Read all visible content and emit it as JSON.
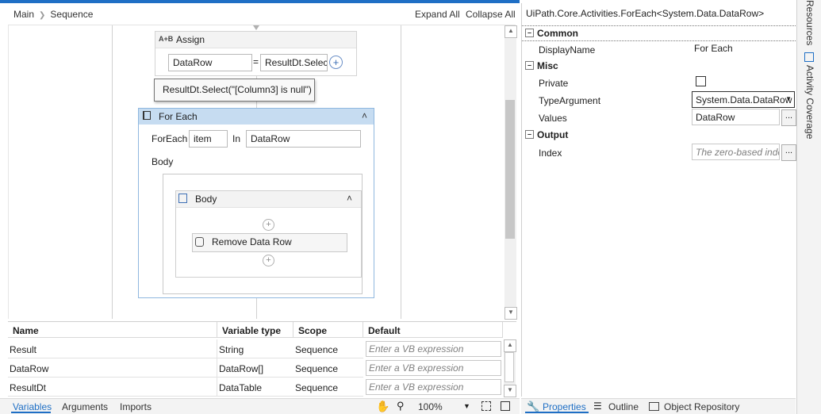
{
  "breadcrumb": [
    "Main",
    "Sequence"
  ],
  "header": {
    "expand_all": "Expand All",
    "collapse_all": "Collapse All"
  },
  "assign": {
    "title": "Assign",
    "icon": "A+B",
    "to": "DataRow",
    "eq": "=",
    "value": "ResultDt.Select"
  },
  "tooltip": "ResultDt.Select(\"[Column3] is null\")",
  "foreach": {
    "title": "For Each",
    "foreach_label": "ForEach",
    "item": "item",
    "in_label": "In",
    "values": "DataRow",
    "body_label": "Body",
    "inner_title": "Body",
    "activity": "Remove Data Row"
  },
  "variables": {
    "columns": [
      "Name",
      "Variable type",
      "Scope",
      "Default"
    ],
    "rows": [
      {
        "name": "Result",
        "type": "String",
        "scope": "Sequence",
        "default": "Enter a VB expression"
      },
      {
        "name": "DataRow",
        "type": "DataRow[]",
        "scope": "Sequence",
        "default": "Enter a VB expression"
      },
      {
        "name": "ResultDt",
        "type": "DataTable",
        "scope": "Sequence",
        "default": "Enter a VB expression"
      }
    ]
  },
  "bottom_tabs": [
    "Variables",
    "Arguments",
    "Imports"
  ],
  "zoom": "100%",
  "properties": {
    "title": "UiPath.Core.Activities.ForEach<System.Data.DataRow>",
    "categories": {
      "common": "Common",
      "misc": "Misc",
      "output": "Output"
    },
    "display_name": {
      "label": "DisplayName",
      "value": "For Each"
    },
    "private": {
      "label": "Private"
    },
    "type_argument": {
      "label": "TypeArgument",
      "value": "System.Data.DataRow"
    },
    "values": {
      "label": "Values",
      "value": "DataRow"
    },
    "index": {
      "label": "Index",
      "placeholder": "The zero-based index"
    },
    "ellipsis": "..."
  },
  "props_tabs": [
    "Properties",
    "Outline",
    "Object Repository"
  ],
  "side_tabs": [
    "Resources",
    "Activity Coverage"
  ],
  "colors": {
    "accent": "#1f6fc5",
    "foreach_header": "#c6dcf1"
  }
}
